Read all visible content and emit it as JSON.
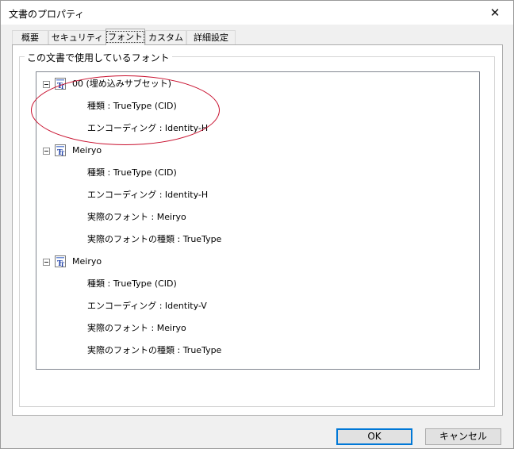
{
  "window": {
    "title": "文書のプロパティ",
    "close_glyph": "✕"
  },
  "tabs": [
    {
      "label": "概要",
      "active": false
    },
    {
      "label": "セキュリティ",
      "active": false
    },
    {
      "label": "フォント",
      "active": true
    },
    {
      "label": "カスタム",
      "active": false
    },
    {
      "label": "詳細設定",
      "active": false
    }
  ],
  "fonts_group": {
    "label": "この文書で使用しているフォント"
  },
  "font_tree": [
    {
      "name": "00 (埋め込みサブセット)",
      "expander": "⊟",
      "icon": "truetype-font-icon",
      "details": [
        "種類 : TrueType (CID)",
        "エンコーディング : Identity-H"
      ]
    },
    {
      "name": "Meiryo",
      "expander": "⊟",
      "icon": "truetype-font-icon",
      "details": [
        "種類 : TrueType (CID)",
        "エンコーディング : Identity-H",
        "実際のフォント : Meiryo",
        "実際のフォントの種類 : TrueType"
      ]
    },
    {
      "name": "Meiryo",
      "expander": "⊟",
      "icon": "truetype-font-icon",
      "details": [
        "種類 : TrueType (CID)",
        "エンコーディング : Identity-V",
        "実際のフォント : Meiryo",
        "実際のフォントの種類 : TrueType"
      ]
    }
  ],
  "buttons": {
    "ok_label": "OK",
    "cancel_label": "キャンセル"
  },
  "colors": {
    "annotation_circle": "#c8102e",
    "default_button_border": "#0078d7",
    "font_icon_blue": "#1e3fa8"
  }
}
